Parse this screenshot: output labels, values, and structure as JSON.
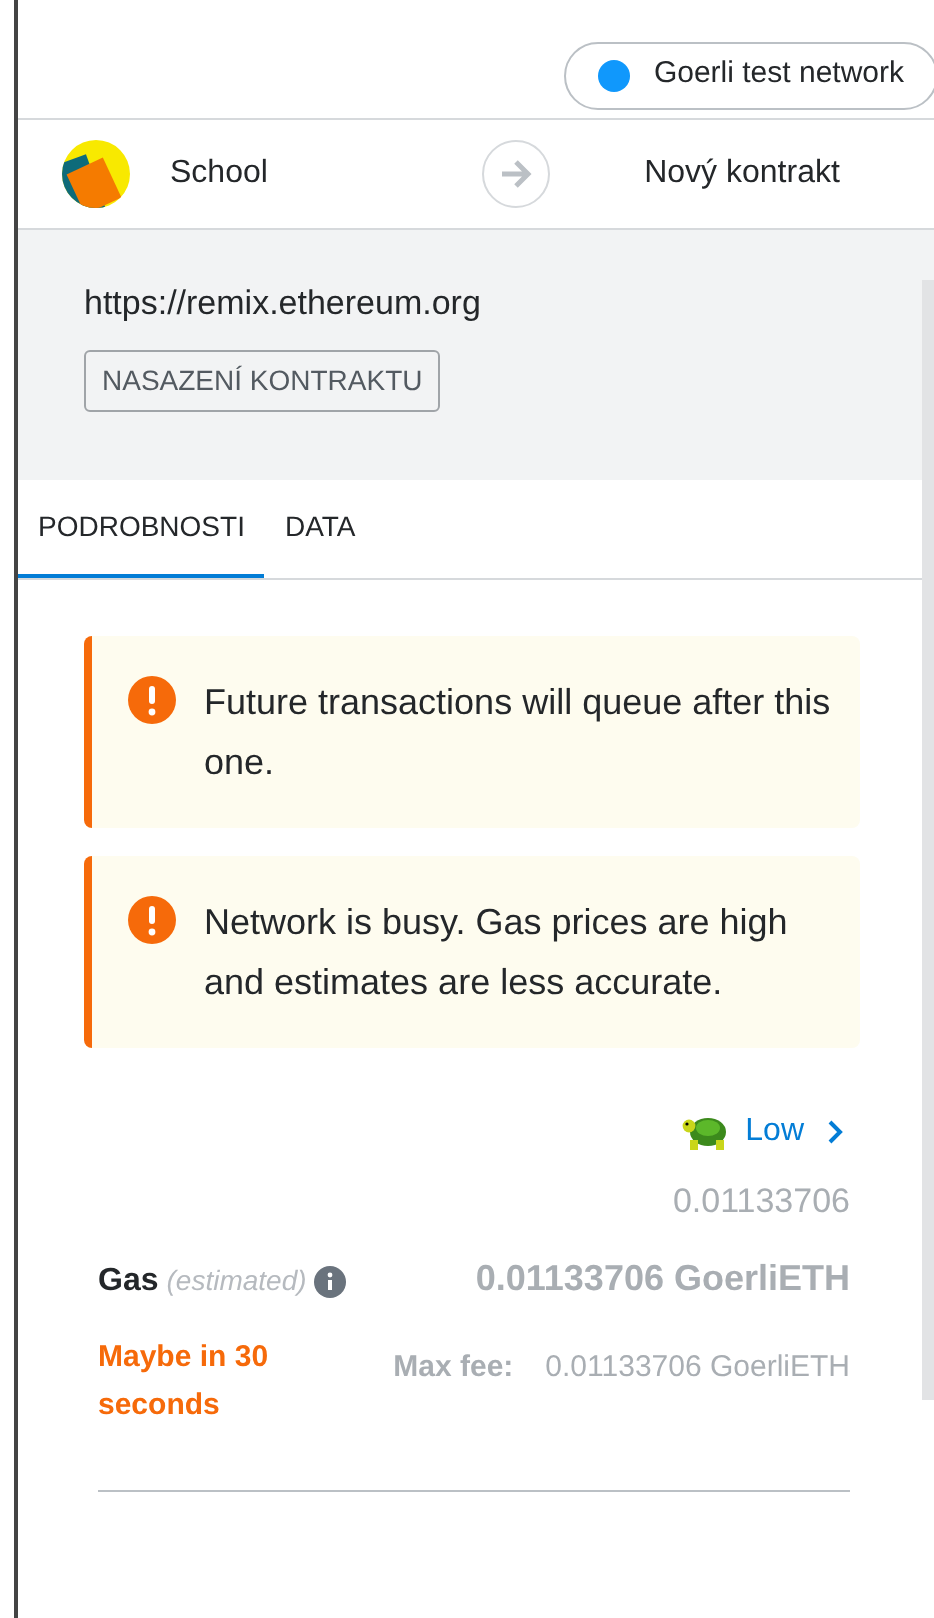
{
  "network": {
    "label": "Goerli test network",
    "color": "#1098fc"
  },
  "accounts": {
    "from": "School",
    "to": "Nový kontrakt"
  },
  "origin": "https://remix.ethereum.org",
  "badge": "NASAZENÍ KONTRAKTU",
  "tabs": [
    {
      "label": "PODROBNOSTI",
      "selected": true
    },
    {
      "label": "DATA",
      "selected": false
    }
  ],
  "alerts": [
    {
      "text": "Future transactions will queue after this one."
    },
    {
      "text": "Network is busy. Gas prices are high and estimates are less accurate."
    }
  ],
  "gas_setting": {
    "label": "Low"
  },
  "gas": {
    "label": "Gas",
    "note": "(estimated)",
    "fiat": "0.01133706",
    "amount": "0.01133706 GoerliETH",
    "timing": "Maybe in 30 seconds",
    "max_fee_label": "Max fee:",
    "max_fee": "0.01133706 GoerliETH"
  }
}
